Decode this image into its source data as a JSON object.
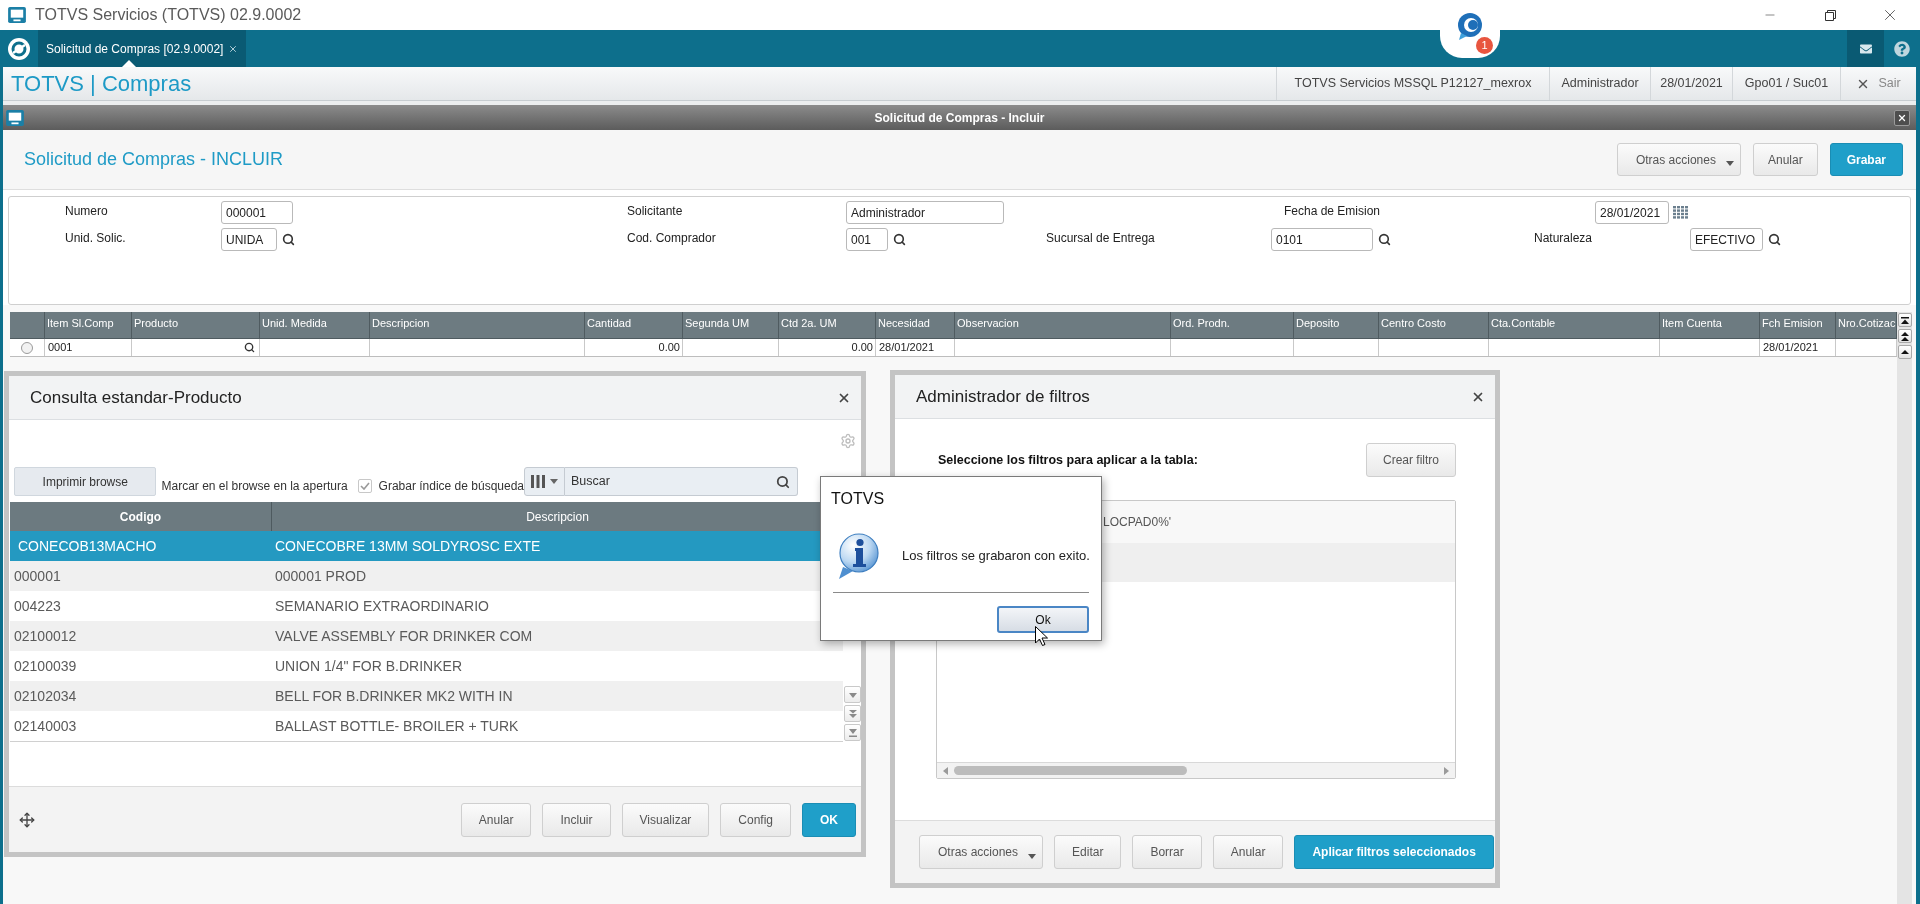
{
  "window": {
    "title": "TOTVS Servicios (TOTVS) 02.9.0002"
  },
  "app_tabs": [
    {
      "label": "Solicitud de Compras [02.9.0002]",
      "selected": true
    }
  ],
  "chat": {
    "badge": "1"
  },
  "header": {
    "brand": "TOTVS | Compras",
    "info": [
      "TOTVS Servicios MSSQL P12127_mexrox",
      "Administrador",
      "28/01/2021",
      "Gpo01 / Suc01"
    ],
    "logout": "Sair"
  },
  "form_window": {
    "title": "Solicitud de Compras - Incluir",
    "heading": "Solicitud de Compras - INCLUIR",
    "actions": [
      {
        "label": "Otras acciones",
        "kind": "menu"
      },
      {
        "label": "Anular",
        "kind": "default"
      },
      {
        "label": "Grabar",
        "kind": "primary"
      }
    ],
    "fields": [
      [
        {
          "label": "Numero",
          "value": "000001",
          "kind": "text"
        },
        {
          "label": "Solicitante",
          "value": "Administrador",
          "kind": "text"
        },
        {
          "label": "Fecha de Emision",
          "value": "28/01/2021",
          "kind": "date"
        }
      ],
      [
        {
          "label": "Unid. Solic.",
          "value": "UNIDA",
          "kind": "lookup"
        },
        {
          "label": "Cod. Comprador",
          "value": "001",
          "kind": "lookup"
        },
        {
          "label": "Sucursal de Entrega",
          "value": "0101",
          "kind": "lookup"
        },
        {
          "label": "Naturaleza",
          "value": "EFECTIVO",
          "kind": "lookup"
        }
      ]
    ],
    "grid": {
      "columns": [
        {
          "label": "Item Sl.Comp",
          "kind": "text"
        },
        {
          "label": "Producto",
          "kind": "lookup"
        },
        {
          "label": "Unid. Medida",
          "kind": "text"
        },
        {
          "label": "Descripcion",
          "kind": "text"
        },
        {
          "label": "Cantidad",
          "kind": "number"
        },
        {
          "label": "Segunda UM",
          "kind": "text"
        },
        {
          "label": "Ctd 2a. UM",
          "kind": "number"
        },
        {
          "label": "Necesidad",
          "kind": "text"
        },
        {
          "label": "Observacion",
          "kind": "text"
        },
        {
          "label": "Ord. Prodn.",
          "kind": "text"
        },
        {
          "label": "Deposito",
          "kind": "text"
        },
        {
          "label": "Centro Costo",
          "kind": "text"
        },
        {
          "label": "Cta.Contable",
          "kind": "text"
        },
        {
          "label": "Item Cuenta",
          "kind": "text"
        },
        {
          "label": "Fch Emision",
          "kind": "text"
        },
        {
          "label": "Nro.Cotizac",
          "kind": "text"
        }
      ],
      "rows": [
        {
          "selected": false,
          "cells": [
            "0001",
            null,
            null,
            null,
            "0.00",
            null,
            "0.00",
            "28/01/2021",
            null,
            null,
            null,
            null,
            null,
            null,
            "28/01/2021",
            null
          ]
        }
      ]
    }
  },
  "lookup_dialog": {
    "title": "Consulta estandar-Producto",
    "print_button": "Imprimir browse",
    "options": [
      {
        "kind": "text",
        "label": "Marcar en el browse en la apertura"
      },
      {
        "kind": "checkbox",
        "label": "Grabar índice de búsqueda",
        "checked": true
      }
    ],
    "search": {
      "placeholder": "Buscar"
    },
    "table": {
      "columns": [
        {
          "label": "Codigo",
          "sorted": true
        },
        {
          "label": "Descripcion",
          "sorted": false
        }
      ],
      "rows": [
        {
          "selected": true,
          "cells": [
            "CONECOB13MACHO",
            "CONECOBRE 13MM SOLDYROSC EXTE"
          ]
        },
        {
          "selected": false,
          "cells": [
            "000001",
            "000001 PROD"
          ]
        },
        {
          "selected": false,
          "cells": [
            "004223",
            "SEMANARIO EXTRAORDINARIO"
          ]
        },
        {
          "selected": false,
          "cells": [
            "02100012",
            "VALVE ASSEMBLY FOR DRINKER COM"
          ]
        },
        {
          "selected": false,
          "cells": [
            "02100039",
            "UNION 1/4\" FOR B.DRINKER"
          ]
        },
        {
          "selected": false,
          "cells": [
            "02102034",
            "BELL FOR B.DRINKER MK2 WITH IN"
          ]
        },
        {
          "selected": false,
          "cells": [
            "02140003",
            "BALLAST BOTTLE- BROILER + TURK"
          ]
        }
      ]
    },
    "buttons": [
      {
        "label": "Anular",
        "kind": "default"
      },
      {
        "label": "Incluir",
        "kind": "default"
      },
      {
        "label": "Visualizar",
        "kind": "default"
      },
      {
        "label": "Config",
        "kind": "default"
      },
      {
        "label": "OK",
        "kind": "primary"
      }
    ]
  },
  "filter_dialog": {
    "title": "Administrador de filtros",
    "instruction": "Seleccione los filtros para aplicar a la tabla:",
    "create_button": "Crear filtro",
    "filters": [
      {
        "text": "LOCPAD0%'"
      }
    ],
    "buttons": [
      {
        "label": "Otras acciones",
        "kind": "menu"
      },
      {
        "label": "Editar",
        "kind": "default"
      },
      {
        "label": "Borrar",
        "kind": "default"
      },
      {
        "label": "Anular",
        "kind": "default"
      },
      {
        "label": "Aplicar filtros seleccionados",
        "kind": "primary"
      }
    ]
  },
  "message_box": {
    "title": "TOTVS",
    "message": "Los filtros se grabaron con exito.",
    "button": "Ok"
  }
}
